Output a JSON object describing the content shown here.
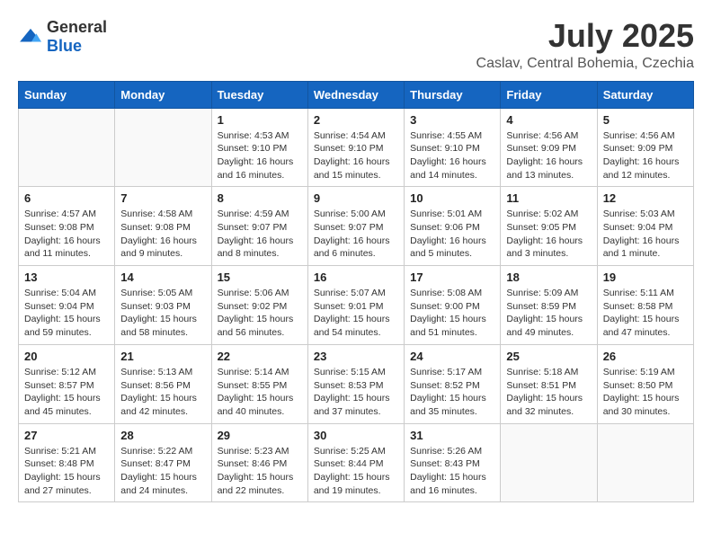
{
  "logo": {
    "general": "General",
    "blue": "Blue"
  },
  "title": {
    "month": "July 2025",
    "location": "Caslav, Central Bohemia, Czechia"
  },
  "weekdays": [
    "Sunday",
    "Monday",
    "Tuesday",
    "Wednesday",
    "Thursday",
    "Friday",
    "Saturday"
  ],
  "weeks": [
    [
      {
        "day": "",
        "sunrise": "",
        "sunset": "",
        "daylight": ""
      },
      {
        "day": "",
        "sunrise": "",
        "sunset": "",
        "daylight": ""
      },
      {
        "day": "1",
        "sunrise": "Sunrise: 4:53 AM",
        "sunset": "Sunset: 9:10 PM",
        "daylight": "Daylight: 16 hours and 16 minutes."
      },
      {
        "day": "2",
        "sunrise": "Sunrise: 4:54 AM",
        "sunset": "Sunset: 9:10 PM",
        "daylight": "Daylight: 16 hours and 15 minutes."
      },
      {
        "day": "3",
        "sunrise": "Sunrise: 4:55 AM",
        "sunset": "Sunset: 9:10 PM",
        "daylight": "Daylight: 16 hours and 14 minutes."
      },
      {
        "day": "4",
        "sunrise": "Sunrise: 4:56 AM",
        "sunset": "Sunset: 9:09 PM",
        "daylight": "Daylight: 16 hours and 13 minutes."
      },
      {
        "day": "5",
        "sunrise": "Sunrise: 4:56 AM",
        "sunset": "Sunset: 9:09 PM",
        "daylight": "Daylight: 16 hours and 12 minutes."
      }
    ],
    [
      {
        "day": "6",
        "sunrise": "Sunrise: 4:57 AM",
        "sunset": "Sunset: 9:08 PM",
        "daylight": "Daylight: 16 hours and 11 minutes."
      },
      {
        "day": "7",
        "sunrise": "Sunrise: 4:58 AM",
        "sunset": "Sunset: 9:08 PM",
        "daylight": "Daylight: 16 hours and 9 minutes."
      },
      {
        "day": "8",
        "sunrise": "Sunrise: 4:59 AM",
        "sunset": "Sunset: 9:07 PM",
        "daylight": "Daylight: 16 hours and 8 minutes."
      },
      {
        "day": "9",
        "sunrise": "Sunrise: 5:00 AM",
        "sunset": "Sunset: 9:07 PM",
        "daylight": "Daylight: 16 hours and 6 minutes."
      },
      {
        "day": "10",
        "sunrise": "Sunrise: 5:01 AM",
        "sunset": "Sunset: 9:06 PM",
        "daylight": "Daylight: 16 hours and 5 minutes."
      },
      {
        "day": "11",
        "sunrise": "Sunrise: 5:02 AM",
        "sunset": "Sunset: 9:05 PM",
        "daylight": "Daylight: 16 hours and 3 minutes."
      },
      {
        "day": "12",
        "sunrise": "Sunrise: 5:03 AM",
        "sunset": "Sunset: 9:04 PM",
        "daylight": "Daylight: 16 hours and 1 minute."
      }
    ],
    [
      {
        "day": "13",
        "sunrise": "Sunrise: 5:04 AM",
        "sunset": "Sunset: 9:04 PM",
        "daylight": "Daylight: 15 hours and 59 minutes."
      },
      {
        "day": "14",
        "sunrise": "Sunrise: 5:05 AM",
        "sunset": "Sunset: 9:03 PM",
        "daylight": "Daylight: 15 hours and 58 minutes."
      },
      {
        "day": "15",
        "sunrise": "Sunrise: 5:06 AM",
        "sunset": "Sunset: 9:02 PM",
        "daylight": "Daylight: 15 hours and 56 minutes."
      },
      {
        "day": "16",
        "sunrise": "Sunrise: 5:07 AM",
        "sunset": "Sunset: 9:01 PM",
        "daylight": "Daylight: 15 hours and 54 minutes."
      },
      {
        "day": "17",
        "sunrise": "Sunrise: 5:08 AM",
        "sunset": "Sunset: 9:00 PM",
        "daylight": "Daylight: 15 hours and 51 minutes."
      },
      {
        "day": "18",
        "sunrise": "Sunrise: 5:09 AM",
        "sunset": "Sunset: 8:59 PM",
        "daylight": "Daylight: 15 hours and 49 minutes."
      },
      {
        "day": "19",
        "sunrise": "Sunrise: 5:11 AM",
        "sunset": "Sunset: 8:58 PM",
        "daylight": "Daylight: 15 hours and 47 minutes."
      }
    ],
    [
      {
        "day": "20",
        "sunrise": "Sunrise: 5:12 AM",
        "sunset": "Sunset: 8:57 PM",
        "daylight": "Daylight: 15 hours and 45 minutes."
      },
      {
        "day": "21",
        "sunrise": "Sunrise: 5:13 AM",
        "sunset": "Sunset: 8:56 PM",
        "daylight": "Daylight: 15 hours and 42 minutes."
      },
      {
        "day": "22",
        "sunrise": "Sunrise: 5:14 AM",
        "sunset": "Sunset: 8:55 PM",
        "daylight": "Daylight: 15 hours and 40 minutes."
      },
      {
        "day": "23",
        "sunrise": "Sunrise: 5:15 AM",
        "sunset": "Sunset: 8:53 PM",
        "daylight": "Daylight: 15 hours and 37 minutes."
      },
      {
        "day": "24",
        "sunrise": "Sunrise: 5:17 AM",
        "sunset": "Sunset: 8:52 PM",
        "daylight": "Daylight: 15 hours and 35 minutes."
      },
      {
        "day": "25",
        "sunrise": "Sunrise: 5:18 AM",
        "sunset": "Sunset: 8:51 PM",
        "daylight": "Daylight: 15 hours and 32 minutes."
      },
      {
        "day": "26",
        "sunrise": "Sunrise: 5:19 AM",
        "sunset": "Sunset: 8:50 PM",
        "daylight": "Daylight: 15 hours and 30 minutes."
      }
    ],
    [
      {
        "day": "27",
        "sunrise": "Sunrise: 5:21 AM",
        "sunset": "Sunset: 8:48 PM",
        "daylight": "Daylight: 15 hours and 27 minutes."
      },
      {
        "day": "28",
        "sunrise": "Sunrise: 5:22 AM",
        "sunset": "Sunset: 8:47 PM",
        "daylight": "Daylight: 15 hours and 24 minutes."
      },
      {
        "day": "29",
        "sunrise": "Sunrise: 5:23 AM",
        "sunset": "Sunset: 8:46 PM",
        "daylight": "Daylight: 15 hours and 22 minutes."
      },
      {
        "day": "30",
        "sunrise": "Sunrise: 5:25 AM",
        "sunset": "Sunset: 8:44 PM",
        "daylight": "Daylight: 15 hours and 19 minutes."
      },
      {
        "day": "31",
        "sunrise": "Sunrise: 5:26 AM",
        "sunset": "Sunset: 8:43 PM",
        "daylight": "Daylight: 15 hours and 16 minutes."
      },
      {
        "day": "",
        "sunrise": "",
        "sunset": "",
        "daylight": ""
      },
      {
        "day": "",
        "sunrise": "",
        "sunset": "",
        "daylight": ""
      }
    ]
  ]
}
